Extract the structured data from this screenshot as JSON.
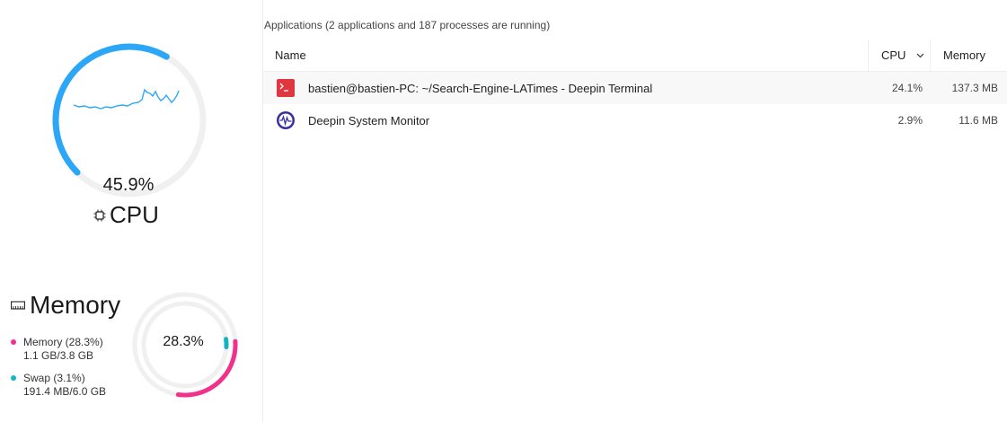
{
  "cpu": {
    "percent_label": "45.9%",
    "percent_value": 45.9,
    "title": "CPU",
    "ring_color": "#2ca7f8",
    "track_color": "#f0f0f0"
  },
  "memory": {
    "title": "Memory",
    "percent_label": "28.3%",
    "memory_fraction": 0.283,
    "swap_fraction": 0.031,
    "memory_color": "#f0328c",
    "swap_color": "#17b3c1",
    "legend": [
      {
        "label": "Memory (28.3%)",
        "detail": "1.1 GB/3.8 GB",
        "color": "#f0328c"
      },
      {
        "label": "Swap (3.1%)",
        "detail": "191.4 MB/6.0 GB",
        "color": "#17b3c1"
      }
    ]
  },
  "processes": {
    "summary": "Applications (2 applications and 187 processes are running)",
    "columns": {
      "name": "Name",
      "cpu": "CPU",
      "memory": "Memory"
    },
    "rows": [
      {
        "icon": "terminal-icon",
        "name": "bastien@bastien-PC: ~/Search-Engine-LATimes - Deepin Terminal",
        "cpu": "24.1%",
        "memory": "137.3 MB"
      },
      {
        "icon": "system-monitor-icon",
        "name": "Deepin System Monitor",
        "cpu": "2.9%",
        "memory": "11.6 MB"
      }
    ]
  }
}
